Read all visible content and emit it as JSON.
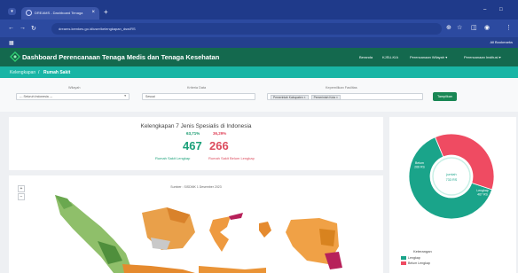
{
  "browser": {
    "tab_title": "DREAMS - Dashboard Tenaga",
    "url": "dreams.kemkes.go.id/user/kelengkapan_dsw/RS",
    "all_bookmarks": "All Bookmarks"
  },
  "app": {
    "title": "Dashboard Perencanaan Tenaga Medis dan Tenaga Kesehatan",
    "menu": [
      "Beranda",
      "KJSU-KIA",
      "Perencanaan Wilayah ▾",
      "Perencanaan Institusi ▾"
    ]
  },
  "breadcrumb": {
    "parent": "Kelengkapan",
    "separator": "/",
    "current": "Rumah Sakit"
  },
  "filters": {
    "wilayah": {
      "label": "Wilayah",
      "value": "--- Seluruh Indonesia ---"
    },
    "kriteria": {
      "label": "Kriteria Data",
      "value": "Sesuai"
    },
    "kepemilikan": {
      "label": "Kepemilikan Fasilitas",
      "chips": [
        "Pemerintah Kabupaten ×",
        "Pemerintah Kota ×"
      ]
    },
    "apply_label": "Tampilkan"
  },
  "summary": {
    "title": "Kelengkapan 7 Jenis Spesialis di Indonesia",
    "lengkap_pct": "63,71%",
    "belum_pct": "36,29%",
    "lengkap_count": "467",
    "belum_count": "266",
    "lengkap_label": "Rumah Sakit Lengkap",
    "belum_label": "Rumah Sakit Belum Lengkap"
  },
  "map": {
    "caption": "Sumber : SISDMK 1 Desember 2023",
    "zoom_in": "+",
    "zoom_out": "−"
  },
  "donut": {
    "center_label": "jumlah",
    "center_value": "733 RS",
    "slices": [
      {
        "name": "Lengkap",
        "value": 467,
        "color": "#1aa48a"
      },
      {
        "name": "Belum Lengkap",
        "value": 266,
        "color": "#ef4b62"
      }
    ],
    "slice_label_lengkap": "Lengkap\n467 RS",
    "slice_label_belum": "Belum\n266 RS"
  },
  "legend": {
    "title": "Keterangan",
    "items": [
      {
        "label": "Lengkap",
        "color": "#1aa48a"
      },
      {
        "label": "Belum Lengkap",
        "color": "#ef4b62"
      }
    ]
  }
}
